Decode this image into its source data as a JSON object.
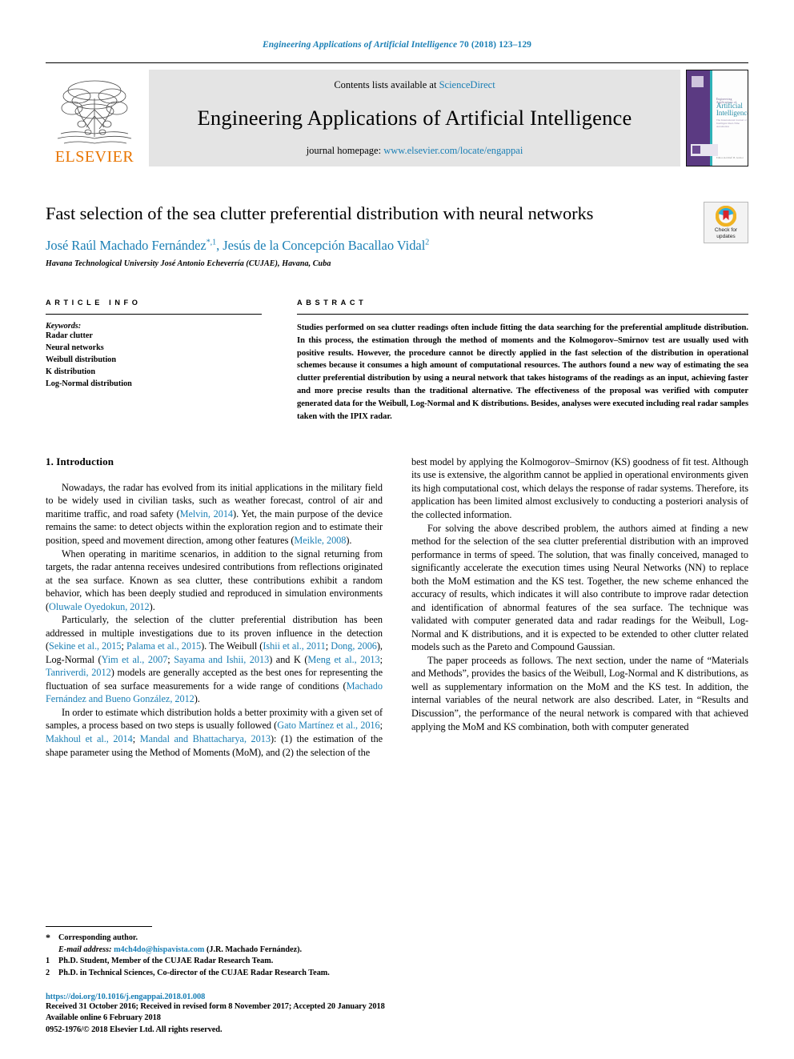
{
  "running_head": {
    "journal_italic": "Engineering Applications of Artificial Intelligence",
    "volume_pages": "70 (2018) 123–129"
  },
  "banner": {
    "publisher_name": "ELSEVIER",
    "contents_prefix": "Contents lists available at",
    "contents_link": "ScienceDirect",
    "journal_title": "Engineering Applications of Artificial Intelligence",
    "homepage_prefix": "journal homepage:",
    "homepage_url": "www.elsevier.com/locate/engappai",
    "cover": {
      "line1": "Engineering Applications of",
      "line2": "Artificial",
      "line3": "Intelligence",
      "line4": "The International Journal of Intelligent Real-Time Automation",
      "footer": "Editor-in-Chief: B. Grabot",
      "ifac_label": "IFAC"
    }
  },
  "article": {
    "title": "Fast selection of the sea clutter preferential distribution with neural networks",
    "authors_html": "José Raúl Machado Fernández *,1, Jesús de la Concepción Bacallao Vidal 2",
    "author1": "José Raúl Machado Fernández",
    "author1_marks": "*,1",
    "author2": "Jesús de la Concepción Bacallao Vidal",
    "author2_marks": "2",
    "affiliation": "Havana Technological University José Antonio Echeverría (CUJAE), Havana, Cuba",
    "crossmark_line1": "Check for",
    "crossmark_line2": "updates"
  },
  "article_info": {
    "heading": "ARTICLE INFO",
    "keywords_label": "Keywords:",
    "keywords": [
      "Radar clutter",
      "Neural networks",
      "Weibull distribution",
      "K distribution",
      "Log-Normal distribution"
    ]
  },
  "abstract": {
    "heading": "ABSTRACT",
    "text": "Studies performed on sea clutter readings often include fitting the data searching for the preferential amplitude distribution. In this process, the estimation through the method of moments and the Kolmogorov–Smirnov test are usually used with positive results. However, the procedure cannot be directly applied in the fast selection of the distribution in operational schemes because it consumes a high amount of computational resources. The authors found a new way of estimating the sea clutter preferential distribution by using a neural network that takes histograms of the readings as an input, achieving faster and more precise results than the traditional alternative. The effectiveness of the proposal was verified with computer generated data for the Weibull, Log-Normal and K distributions. Besides, analyses were executed including real radar samples taken with the IPIX radar."
  },
  "body": {
    "section_number_title": "1. Introduction",
    "left_paragraphs": [
      {
        "segments": [
          {
            "t": "Nowadays, the radar has evolved from its initial applications in the military field to be widely used in civilian tasks, such as weather forecast, control of air and maritime traffic, and road safety ("
          },
          {
            "t": "Melvin, 2014",
            "link": true
          },
          {
            "t": "). Yet, the main purpose of the device remains the same: to detect objects within the exploration region and to estimate their position, speed and movement direction, among other features ("
          },
          {
            "t": "Meikle, 2008",
            "link": true
          },
          {
            "t": ")."
          }
        ]
      },
      {
        "segments": [
          {
            "t": "When operating in maritime scenarios, in addition to the signal returning from targets, the radar antenna receives undesired contributions from reflections originated at the sea surface. Known as sea clutter, these contributions exhibit a random behavior, which has been deeply studied and reproduced in simulation environments ("
          },
          {
            "t": "Oluwale Oyedokun, 2012",
            "link": true
          },
          {
            "t": ")."
          }
        ]
      },
      {
        "segments": [
          {
            "t": "Particularly, the selection of the clutter preferential distribution has been addressed in multiple investigations due to its proven influence in the detection  ("
          },
          {
            "t": "Sekine et al., 2015",
            "link": true
          },
          {
            "t": "; "
          },
          {
            "t": "Palama et al., 2015",
            "link": true
          },
          {
            "t": "). The Weibull ("
          },
          {
            "t": "Ishii et al., 2011",
            "link": true
          },
          {
            "t": "; "
          },
          {
            "t": "Dong, 2006",
            "link": true
          },
          {
            "t": "), Log-Normal  ("
          },
          {
            "t": "Yim et al., 2007",
            "link": true
          },
          {
            "t": "; "
          },
          {
            "t": "Sayama and Ishii, 2013",
            "link": true
          },
          {
            "t": ") and K ("
          },
          {
            "t": "Meng et al., 2013",
            "link": true
          },
          {
            "t": "; "
          },
          {
            "t": "Tanriverdi, 2012",
            "link": true
          },
          {
            "t": ") models are generally accepted as the best ones for representing the fluctuation of sea surface measurements for a wide range of conditions ("
          },
          {
            "t": "Machado Fernández and Bueno González, 2012",
            "link": true
          },
          {
            "t": ")."
          }
        ]
      },
      {
        "segments": [
          {
            "t": "In order to estimate which distribution holds a better proximity with a given set of samples, a process based on two steps is usually followed ("
          },
          {
            "t": "Gato Martínez et al., 2016",
            "link": true
          },
          {
            "t": "; "
          },
          {
            "t": "Makhoul et al., 2014",
            "link": true
          },
          {
            "t": "; "
          },
          {
            "t": "Mandal and Bhattacharya, 2013",
            "link": true
          },
          {
            "t": "): (1) the estimation of the shape parameter using the Method of Moments (MoM), and (2) the selection of the"
          }
        ]
      }
    ],
    "right_paragraphs": [
      {
        "continuation": true,
        "segments": [
          {
            "t": "best model by applying the Kolmogorov–Smirnov (KS) goodness of fit test. Although its use is extensive, the algorithm cannot be applied in operational environments given its high computational cost, which delays the response of radar systems. Therefore, its application has been limited almost exclusively to conducting a posteriori analysis of the collected information."
          }
        ]
      },
      {
        "segments": [
          {
            "t": "For solving the above described problem, the authors aimed at finding a new method for the selection of the sea clutter preferential distribution with an improved performance in terms of speed. The solution, that was finally conceived, managed to significantly accelerate the execution times using Neural Networks (NN) to replace both the MoM estimation and the KS test. Together, the new scheme enhanced the accuracy of results, which indicates it will also contribute to improve radar detection and identification of abnormal features of the sea surface. The technique was validated with computer generated data and radar readings for the Weibull, Log-Normal and K distributions, and it is expected to be extended to other clutter related models such as the Pareto and Compound Gaussian."
          }
        ]
      },
      {
        "segments": [
          {
            "t": "The paper proceeds as follows. The next section, under the name of “Materials and Methods”, provides the basics of the Weibull, Log-Normal and K distributions, as well as supplementary information on the MoM and the KS test. In addition, the internal variables of the neural network are also described. Later, in “Results and Discussion”, the performance of the neural network is compared with that achieved applying the MoM and KS combination, both with computer generated"
          }
        ]
      }
    ]
  },
  "footnotes": [
    {
      "mark": "*",
      "star": true,
      "text": "Corresponding author.",
      "email_label": "E-mail address:",
      "email": "m4ch4do@hispavista.com",
      "email_suffix": "(J.R. Machado Fernández)."
    },
    {
      "mark": "1",
      "text": "Ph.D. Student, Member of the CUJAE Radar Research Team."
    },
    {
      "mark": "2",
      "text": "Ph.D. in Technical Sciences, Co-director of the CUJAE Radar Research Team."
    }
  ],
  "bottom_meta": {
    "doi": "https://doi.org/10.1016/j.engappai.2018.01.008",
    "received": "Received 31 October 2016; Received in revised form 8 November 2017; Accepted 20 January 2018",
    "available": "Available online 6 February 2018",
    "copyright": "0952-1976/© 2018 Elsevier Ltd. All rights reserved."
  },
  "colors": {
    "link": "#1a7fb5",
    "elsevier_orange": "#e87500",
    "banner_gray": "#e4e4e4"
  }
}
